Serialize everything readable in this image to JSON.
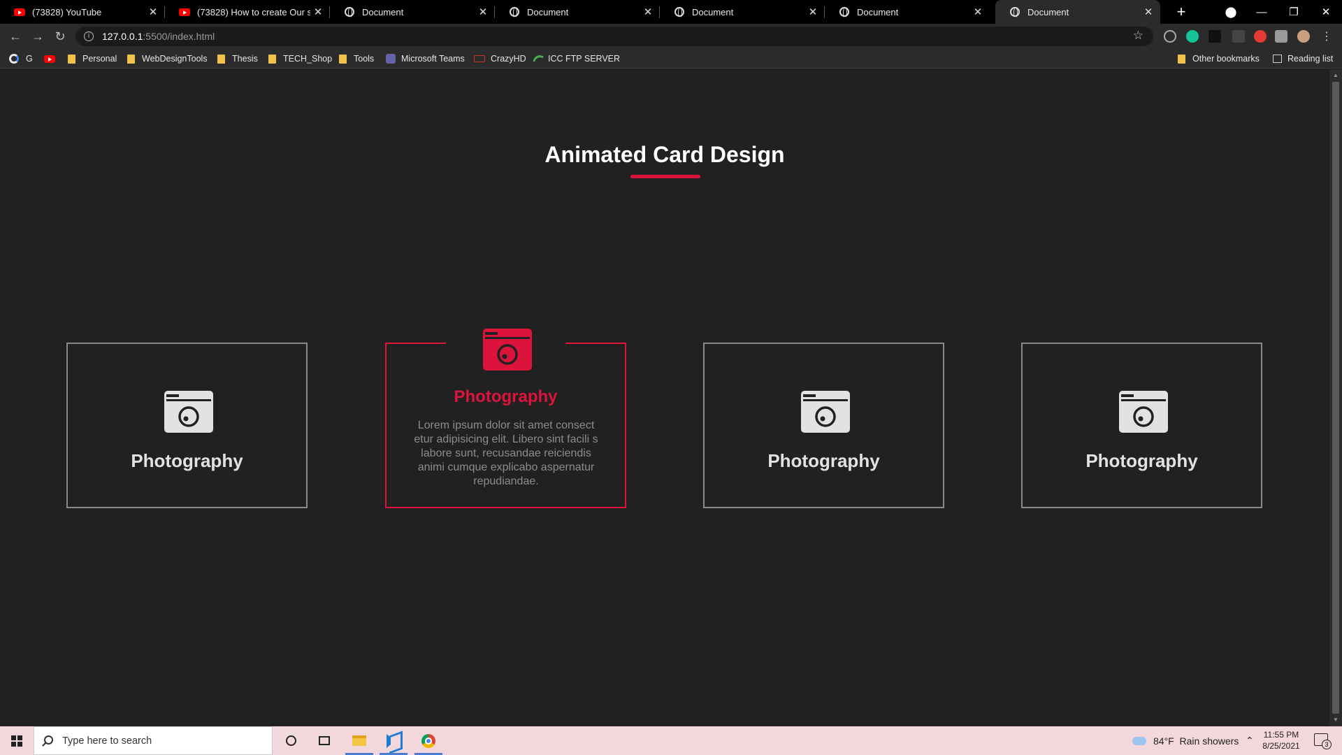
{
  "tabs": [
    {
      "title": "(73828) YouTube",
      "favicon": "youtube-icon"
    },
    {
      "title": "(73828) How to create Our servi",
      "favicon": "youtube-icon"
    },
    {
      "title": "Document",
      "favicon": "globe-icon"
    },
    {
      "title": "Document",
      "favicon": "globe-icon"
    },
    {
      "title": "Document",
      "favicon": "globe-icon"
    },
    {
      "title": "Document",
      "favicon": "globe-icon"
    },
    {
      "title": "Document",
      "favicon": "globe-icon",
      "active": true
    }
  ],
  "address": {
    "host": "127.0.0.1",
    "path": ":5500/index.html"
  },
  "bookmarks": {
    "g": "G",
    "personal": "Personal",
    "webdesign": "WebDesignTools",
    "thesis": "Thesis",
    "techshop": "TECH_Shop",
    "tools": "Tools",
    "teams": "Microsoft Teams",
    "crazyhd": "CrazyHD",
    "icc": "ICC FTP SERVER",
    "other": "Other bookmarks",
    "reading": "Reading list"
  },
  "page": {
    "heading": "Animated Card Design",
    "accent_color": "#dc143c",
    "cards": [
      {
        "label": "Photography"
      },
      {
        "label": "Photography",
        "description": "Lorem ipsum dolor sit amet consect etur adipisicing elit. Libero sint facili s labore sunt, recusandae reiciendis animi cumque explicabo aspernatur repudiandae."
      },
      {
        "label": "Photography"
      },
      {
        "label": "Photography"
      }
    ]
  },
  "taskbar": {
    "search_placeholder": "Type here to search",
    "weather_temp": "84°F",
    "weather_desc": "Rain showers",
    "time": "11:55 PM",
    "date": "8/25/2021",
    "notifications": "3"
  }
}
